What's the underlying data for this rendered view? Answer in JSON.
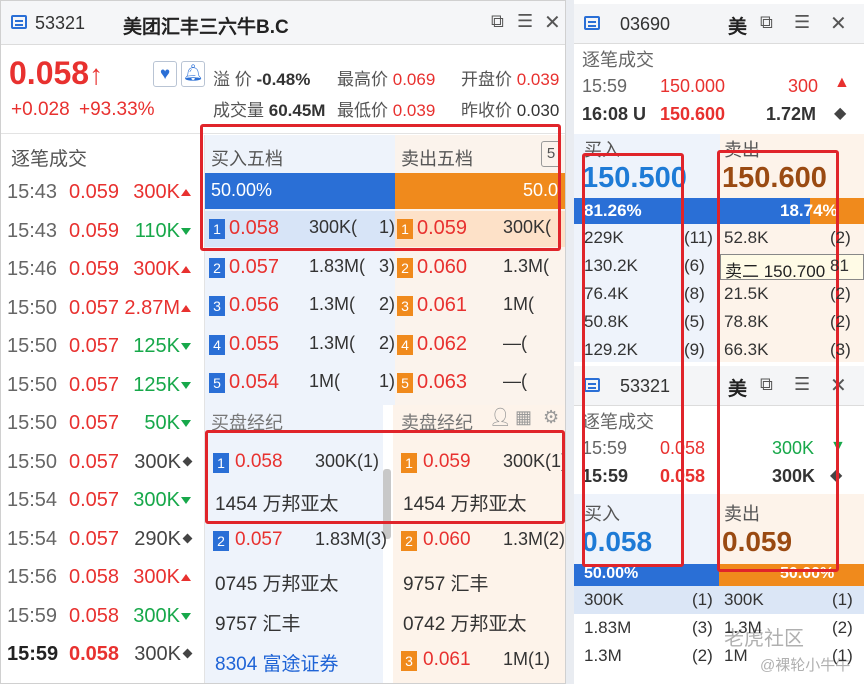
{
  "left": {
    "code": "53321",
    "name": "美团汇丰三六牛B.C",
    "price": "0.058",
    "change": "+0.028",
    "change_pct": "+93.33%",
    "stats": {
      "premium_label": "溢 价",
      "premium": "-0.48%",
      "high_label": "最高价",
      "high": "0.069",
      "open_label": "开盘价",
      "open": "0.039",
      "volume_label": "成交量",
      "volume": "60.45M",
      "low_label": "最低价",
      "low": "0.039",
      "prev_close_label": "昨收价",
      "prev_close": "0.030"
    },
    "trades_title": "逐笔成交",
    "trades": [
      {
        "time": "15:43",
        "price": "0.059",
        "vol": "300K",
        "dir": "up"
      },
      {
        "time": "15:43",
        "price": "0.059",
        "vol": "110K",
        "dir": "down"
      },
      {
        "time": "15:46",
        "price": "0.059",
        "vol": "300K",
        "dir": "up"
      },
      {
        "time": "15:50",
        "price": "0.057",
        "vol": "2.87M",
        "dir": "up"
      },
      {
        "time": "15:50",
        "price": "0.057",
        "vol": "125K",
        "dir": "down"
      },
      {
        "time": "15:50",
        "price": "0.057",
        "vol": "125K",
        "dir": "down"
      },
      {
        "time": "15:50",
        "price": "0.057",
        "vol": "50K",
        "dir": "down"
      },
      {
        "time": "15:50",
        "price": "0.057",
        "vol": "300K",
        "dir": "neutral"
      },
      {
        "time": "15:54",
        "price": "0.057",
        "vol": "300K",
        "dir": "down"
      },
      {
        "time": "15:54",
        "price": "0.057",
        "vol": "290K",
        "dir": "neutral"
      },
      {
        "time": "15:56",
        "price": "0.058",
        "vol": "300K",
        "dir": "up"
      },
      {
        "time": "15:59",
        "price": "0.058",
        "vol": "300K",
        "dir": "down"
      },
      {
        "time": "15:59",
        "price": "0.058",
        "vol": "300K",
        "dir": "neutral"
      }
    ],
    "buy_title": "买入五档",
    "sell_title": "卖出五档",
    "bid_pct": "50.00%",
    "ask_pct": "50.0",
    "bids": [
      {
        "n": "1",
        "price": "0.058",
        "vol": "300K(",
        "cnt": "1)"
      },
      {
        "n": "2",
        "price": "0.057",
        "vol": "1.83M(",
        "cnt": "3)"
      },
      {
        "n": "3",
        "price": "0.056",
        "vol": "1.3M(",
        "cnt": "2)"
      },
      {
        "n": "4",
        "price": "0.055",
        "vol": "1.3M(",
        "cnt": "2)"
      },
      {
        "n": "5",
        "price": "0.054",
        "vol": "1M(",
        "cnt": "1)"
      }
    ],
    "asks": [
      {
        "n": "1",
        "price": "0.059",
        "vol": "300K("
      },
      {
        "n": "2",
        "price": "0.060",
        "vol": "1.3M("
      },
      {
        "n": "3",
        "price": "0.061",
        "vol": "1M("
      },
      {
        "n": "4",
        "price": "0.062",
        "vol": "—("
      },
      {
        "n": "5",
        "price": "0.063",
        "vol": "—("
      }
    ],
    "buy_broker_title": "买盘经纪",
    "sell_broker_title": "卖盘经纪",
    "buy_brokers": [
      {
        "n": "1",
        "price": "0.058",
        "vol": "300K(1)",
        "name": "1454 万邦亚太"
      },
      {
        "n": "2",
        "price": "0.057",
        "vol": "1.83M(3)",
        "name": "0745 万邦亚太"
      },
      {
        "name": "9757 汇丰"
      },
      {
        "name": "8304 富途证券"
      }
    ],
    "sell_brokers": [
      {
        "n": "1",
        "price": "0.059",
        "vol": "300K(1)",
        "name": "1454 万邦亚太"
      },
      {
        "n": "2",
        "price": "0.060",
        "vol": "1.3M(2)",
        "name": "9757 汇丰"
      },
      {
        "name": "0742 万邦亚太"
      },
      {
        "n": "3",
        "price": "0.061",
        "vol": "1M(1)"
      }
    ]
  },
  "right_top": {
    "code": "03690",
    "mei": "美",
    "trades_title": "逐笔成交",
    "trades": [
      {
        "time": "15:59",
        "price": "150.000",
        "vol": "300"
      },
      {
        "time": "16:08 U",
        "price": "150.600",
        "vol": "1.72M"
      }
    ],
    "buy_label": "买入",
    "sell_label": "卖出",
    "bid": "150.500",
    "ask": "150.600",
    "bid_pct": "81.26%",
    "ask_pct": "18.74%",
    "rows": [
      {
        "bv": "229K",
        "bc": "(11)",
        "av": "52.8K",
        "ac": "(2)"
      },
      {
        "bv": "130.2K",
        "bc": "(6)",
        "av": "",
        "ac": "81"
      },
      {
        "bv": "76.4K",
        "bc": "(8)",
        "av": "21.5K",
        "ac": "(2)"
      },
      {
        "bv": "50.8K",
        "bc": "(5)",
        "av": "78.8K",
        "ac": "(2)"
      },
      {
        "bv": "129.2K",
        "bc": "(9)",
        "av": "66.3K",
        "ac": "(3)"
      }
    ],
    "tooltip": "卖二 150.700"
  },
  "right_bottom": {
    "code": "53321",
    "mei": "美",
    "trades_title": "逐笔成交",
    "trades": [
      {
        "time": "15:59",
        "price": "0.058",
        "vol": "300K"
      },
      {
        "time": "15:59",
        "price": "0.058",
        "vol": "300K"
      }
    ],
    "buy_label": "买入",
    "sell_label": "卖出",
    "bid": "0.058",
    "ask": "0.059",
    "bid_pct": "50.00%",
    "ask_pct": "50.00%",
    "rows": [
      {
        "bv": "300K",
        "bc": "(1)",
        "av": "300K",
        "ac": "(1)"
      },
      {
        "bv": "1.83M",
        "bc": "(3)",
        "av": "1.3M",
        "ac": "(2)"
      },
      {
        "bv": "1.3M",
        "bc": "(2)",
        "av": "1M",
        "ac": "(1)"
      }
    ]
  },
  "watermark": {
    "brand": "老虎社区",
    "author": "@裸轮小牛牛"
  },
  "colors": {
    "red": "#e8312f",
    "green": "#17a84a",
    "blue": "#2a6fd6",
    "orange": "#f08a1c",
    "ask_brown": "#9a4a12",
    "highlight": "#e0242a"
  }
}
